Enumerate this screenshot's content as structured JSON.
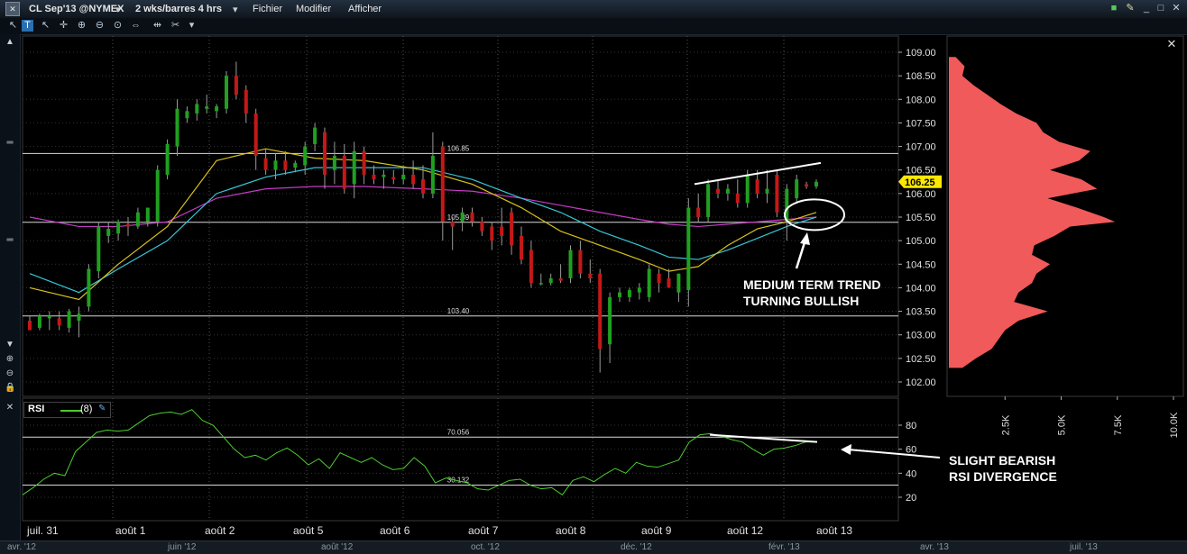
{
  "window": {
    "symbol": "CL Sep'13 @NYMEX",
    "period": "2 wks/barres 4 hrs",
    "menus": [
      "Fichier",
      "Modifier",
      "Afficher"
    ]
  },
  "colors": {
    "background": "#000000",
    "bull_candle": "#1fa11f",
    "bear_candle": "#c41818",
    "ma_fast": "#d9c21a",
    "ma_mid": "#39c6d6",
    "ma_slow": "#c43bc4",
    "volume_profile": "#f05a5a",
    "rsi_line": "#4dcc2f",
    "price_marker": "#ffe800"
  },
  "price_panel": {
    "y_ticks": [
      "109.00",
      "108.50",
      "108.00",
      "107.50",
      "107.00",
      "106.50",
      "106.00",
      "105.50",
      "105.00",
      "104.50",
      "104.00",
      "103.50",
      "103.00",
      "102.50",
      "102.00"
    ],
    "last_price": "106.25",
    "levels": [
      {
        "label": "106.85",
        "value": 106.85
      },
      {
        "label": "105.39",
        "value": 105.39
      },
      {
        "label": "103.40",
        "value": 103.4
      }
    ],
    "annotation": "MEDIUM TERM TREND\nTURNING BULLISH"
  },
  "rsi_panel": {
    "title": "RSI",
    "param": "(8)",
    "y_ticks": [
      "80",
      "60",
      "40",
      "20"
    ],
    "levels": [
      {
        "label": "70.056",
        "value": 70.056
      },
      {
        "label": "30.132",
        "value": 30.132
      }
    ],
    "annotation": "SLIGHT BEARISH\nRSI DIVERGENCE"
  },
  "x_axis_labels": [
    "juil. 31",
    "août 1",
    "août 2",
    "août 5",
    "août 6",
    "août 7",
    "août 8",
    "août 9",
    "août 12",
    "août 13"
  ],
  "profile_axis_labels": [
    "2.5K",
    "5.0K",
    "7.5K",
    "10.0K"
  ],
  "navigator_months": [
    "avr. '12",
    "juin '12",
    "août '12",
    "oct. '12",
    "déc. '12",
    "févr. '13",
    "avr. '13",
    "juil. '13"
  ],
  "chart_data": [
    {
      "type": "candlestick",
      "title": "CL Sep'13 @NYMEX",
      "ylim": [
        101.8,
        109.3
      ],
      "categories": [
        "juil. 31",
        "août 1",
        "août 2",
        "août 5",
        "août 6",
        "août 7",
        "août 8",
        "août 9",
        "août 12",
        "août 13"
      ],
      "candles": [
        {
          "o": 103.3,
          "h": 103.4,
          "l": 103.1,
          "c": 103.1
        },
        {
          "o": 103.15,
          "h": 103.45,
          "l": 103.1,
          "c": 103.4
        },
        {
          "o": 103.35,
          "h": 103.5,
          "l": 103.1,
          "c": 103.4
        },
        {
          "o": 103.35,
          "h": 103.5,
          "l": 103.1,
          "c": 103.2
        },
        {
          "o": 103.15,
          "h": 103.55,
          "l": 103.05,
          "c": 103.5
        },
        {
          "o": 103.3,
          "h": 103.6,
          "l": 102.95,
          "c": 103.45
        },
        {
          "o": 103.6,
          "h": 104.5,
          "l": 103.5,
          "c": 104.4
        },
        {
          "o": 104.35,
          "h": 105.4,
          "l": 104.2,
          "c": 105.3
        },
        {
          "o": 105.1,
          "h": 105.4,
          "l": 104.95,
          "c": 105.25
        },
        {
          "o": 105.15,
          "h": 105.45,
          "l": 105.0,
          "c": 105.4
        },
        {
          "o": 105.35,
          "h": 105.5,
          "l": 105.1,
          "c": 105.3
        },
        {
          "o": 105.3,
          "h": 105.7,
          "l": 105.25,
          "c": 105.6
        },
        {
          "o": 105.4,
          "h": 105.7,
          "l": 105.3,
          "c": 105.7
        },
        {
          "o": 105.4,
          "h": 106.6,
          "l": 105.3,
          "c": 106.5
        },
        {
          "o": 106.4,
          "h": 107.15,
          "l": 106.3,
          "c": 107.05
        },
        {
          "o": 107.0,
          "h": 108.0,
          "l": 106.8,
          "c": 107.8
        },
        {
          "o": 107.6,
          "h": 107.85,
          "l": 107.5,
          "c": 107.75
        },
        {
          "o": 107.7,
          "h": 108.0,
          "l": 107.55,
          "c": 107.9
        },
        {
          "o": 107.8,
          "h": 108.1,
          "l": 107.7,
          "c": 107.85
        },
        {
          "o": 107.75,
          "h": 107.9,
          "l": 107.6,
          "c": 107.85
        },
        {
          "o": 107.8,
          "h": 108.6,
          "l": 107.7,
          "c": 108.5
        },
        {
          "o": 108.5,
          "h": 108.8,
          "l": 108.0,
          "c": 108.1
        },
        {
          "o": 108.2,
          "h": 108.3,
          "l": 107.5,
          "c": 107.7
        },
        {
          "o": 107.7,
          "h": 107.8,
          "l": 106.5,
          "c": 106.8
        },
        {
          "o": 106.75,
          "h": 106.95,
          "l": 106.4,
          "c": 106.5
        },
        {
          "o": 106.5,
          "h": 106.85,
          "l": 106.3,
          "c": 106.7
        },
        {
          "o": 106.7,
          "h": 106.9,
          "l": 106.4,
          "c": 106.5
        },
        {
          "o": 106.55,
          "h": 106.7,
          "l": 106.45,
          "c": 106.65
        },
        {
          "o": 106.6,
          "h": 107.1,
          "l": 106.4,
          "c": 107.0
        },
        {
          "o": 107.05,
          "h": 107.5,
          "l": 106.9,
          "c": 107.4
        },
        {
          "o": 107.3,
          "h": 107.4,
          "l": 106.1,
          "c": 106.4
        },
        {
          "o": 106.5,
          "h": 107.1,
          "l": 106.2,
          "c": 106.8
        },
        {
          "o": 106.8,
          "h": 107.05,
          "l": 106.0,
          "c": 106.1
        },
        {
          "o": 106.2,
          "h": 107.1,
          "l": 105.9,
          "c": 106.9
        },
        {
          "o": 106.9,
          "h": 107.0,
          "l": 106.2,
          "c": 106.4
        },
        {
          "o": 106.4,
          "h": 106.6,
          "l": 106.2,
          "c": 106.3
        },
        {
          "o": 106.35,
          "h": 106.5,
          "l": 106.1,
          "c": 106.4
        },
        {
          "o": 106.35,
          "h": 106.5,
          "l": 106.2,
          "c": 106.3
        },
        {
          "o": 106.3,
          "h": 106.6,
          "l": 106.2,
          "c": 106.4
        },
        {
          "o": 106.4,
          "h": 106.7,
          "l": 106.1,
          "c": 106.2
        },
        {
          "o": 106.3,
          "h": 106.6,
          "l": 105.9,
          "c": 106.0
        },
        {
          "o": 106.0,
          "h": 107.3,
          "l": 105.9,
          "c": 106.8
        },
        {
          "o": 107.0,
          "h": 107.1,
          "l": 105.0,
          "c": 105.4
        },
        {
          "o": 105.4,
          "h": 105.5,
          "l": 104.8,
          "c": 105.3
        },
        {
          "o": 105.4,
          "h": 105.7,
          "l": 105.2,
          "c": 105.6
        },
        {
          "o": 105.6,
          "h": 105.7,
          "l": 105.3,
          "c": 105.4
        },
        {
          "o": 105.4,
          "h": 105.5,
          "l": 105.1,
          "c": 105.2
        },
        {
          "o": 105.3,
          "h": 105.4,
          "l": 104.8,
          "c": 105.0
        },
        {
          "o": 105.3,
          "h": 105.7,
          "l": 104.9,
          "c": 105.1
        },
        {
          "o": 105.6,
          "h": 105.7,
          "l": 104.7,
          "c": 104.9
        },
        {
          "o": 105.1,
          "h": 105.3,
          "l": 104.5,
          "c": 104.6
        },
        {
          "o": 104.8,
          "h": 105.0,
          "l": 104.0,
          "c": 104.1
        },
        {
          "o": 104.1,
          "h": 104.3,
          "l": 104.05,
          "c": 104.1
        },
        {
          "o": 104.1,
          "h": 104.3,
          "l": 104.05,
          "c": 104.2
        },
        {
          "o": 104.2,
          "h": 104.5,
          "l": 104.1,
          "c": 104.15
        },
        {
          "o": 104.2,
          "h": 104.9,
          "l": 104.1,
          "c": 104.8
        },
        {
          "o": 104.8,
          "h": 105.0,
          "l": 104.2,
          "c": 104.3
        },
        {
          "o": 104.3,
          "h": 104.6,
          "l": 104.1,
          "c": 104.2
        },
        {
          "o": 104.3,
          "h": 104.4,
          "l": 102.2,
          "c": 102.7
        },
        {
          "o": 102.8,
          "h": 103.9,
          "l": 102.4,
          "c": 103.8
        },
        {
          "o": 103.8,
          "h": 104.0,
          "l": 103.7,
          "c": 103.9
        },
        {
          "o": 103.8,
          "h": 104.0,
          "l": 103.7,
          "c": 103.95
        },
        {
          "o": 103.9,
          "h": 104.1,
          "l": 103.75,
          "c": 104.0
        },
        {
          "o": 103.8,
          "h": 104.5,
          "l": 103.7,
          "c": 104.4
        },
        {
          "o": 104.3,
          "h": 104.4,
          "l": 103.9,
          "c": 104.1
        },
        {
          "o": 104.2,
          "h": 104.4,
          "l": 104.0,
          "c": 104.0
        },
        {
          "o": 103.9,
          "h": 104.3,
          "l": 103.7,
          "c": 104.3
        },
        {
          "o": 103.95,
          "h": 105.9,
          "l": 103.6,
          "c": 105.7
        },
        {
          "o": 105.7,
          "h": 106.0,
          "l": 105.4,
          "c": 105.5
        },
        {
          "o": 105.5,
          "h": 106.3,
          "l": 105.4,
          "c": 106.2
        },
        {
          "o": 106.1,
          "h": 106.3,
          "l": 105.9,
          "c": 106.0
        },
        {
          "o": 106.0,
          "h": 106.2,
          "l": 105.85,
          "c": 106.1
        },
        {
          "o": 106.0,
          "h": 106.3,
          "l": 105.7,
          "c": 105.8
        },
        {
          "o": 105.8,
          "h": 106.5,
          "l": 105.7,
          "c": 106.4
        },
        {
          "o": 106.3,
          "h": 106.5,
          "l": 105.9,
          "c": 106.0
        },
        {
          "o": 106.0,
          "h": 106.5,
          "l": 105.8,
          "c": 106.1
        },
        {
          "o": 106.4,
          "h": 106.5,
          "l": 105.5,
          "c": 105.6
        },
        {
          "o": 105.4,
          "h": 106.2,
          "l": 105.0,
          "c": 106.1
        },
        {
          "o": 105.9,
          "h": 106.4,
          "l": 105.8,
          "c": 106.3
        },
        {
          "o": 106.2,
          "h": 106.25,
          "l": 106.1,
          "c": 106.15
        },
        {
          "o": 106.15,
          "h": 106.3,
          "l": 106.1,
          "c": 106.25
        }
      ],
      "ma_fast": [
        {
          "x": 0,
          "y": 104.0
        },
        {
          "x": 5,
          "y": 103.75
        },
        {
          "x": 9,
          "y": 104.5
        },
        {
          "x": 14,
          "y": 105.3
        },
        {
          "x": 19,
          "y": 106.7
        },
        {
          "x": 24,
          "y": 106.95
        },
        {
          "x": 29,
          "y": 106.75
        },
        {
          "x": 34,
          "y": 106.7
        },
        {
          "x": 40,
          "y": 106.5
        },
        {
          "x": 45,
          "y": 106.2
        },
        {
          "x": 50,
          "y": 105.7
        },
        {
          "x": 54,
          "y": 105.2
        },
        {
          "x": 58,
          "y": 104.9
        },
        {
          "x": 62,
          "y": 104.6
        },
        {
          "x": 65,
          "y": 104.35
        },
        {
          "x": 68,
          "y": 104.45
        },
        {
          "x": 71,
          "y": 104.9
        },
        {
          "x": 74,
          "y": 105.25
        },
        {
          "x": 77,
          "y": 105.4
        },
        {
          "x": 80,
          "y": 105.6
        }
      ],
      "ma_mid": [
        {
          "x": 0,
          "y": 104.3
        },
        {
          "x": 5,
          "y": 103.9
        },
        {
          "x": 9,
          "y": 104.4
        },
        {
          "x": 14,
          "y": 105.0
        },
        {
          "x": 19,
          "y": 106.0
        },
        {
          "x": 24,
          "y": 106.35
        },
        {
          "x": 29,
          "y": 106.55
        },
        {
          "x": 34,
          "y": 106.55
        },
        {
          "x": 40,
          "y": 106.55
        },
        {
          "x": 45,
          "y": 106.3
        },
        {
          "x": 50,
          "y": 105.9
        },
        {
          "x": 54,
          "y": 105.6
        },
        {
          "x": 58,
          "y": 105.2
        },
        {
          "x": 62,
          "y": 104.9
        },
        {
          "x": 65,
          "y": 104.65
        },
        {
          "x": 68,
          "y": 104.6
        },
        {
          "x": 71,
          "y": 104.8
        },
        {
          "x": 74,
          "y": 105.05
        },
        {
          "x": 77,
          "y": 105.3
        },
        {
          "x": 80,
          "y": 105.5
        }
      ],
      "ma_slow": [
        {
          "x": 0,
          "y": 105.5
        },
        {
          "x": 5,
          "y": 105.3
        },
        {
          "x": 9,
          "y": 105.3
        },
        {
          "x": 14,
          "y": 105.4
        },
        {
          "x": 19,
          "y": 105.9
        },
        {
          "x": 24,
          "y": 106.1
        },
        {
          "x": 29,
          "y": 106.15
        },
        {
          "x": 34,
          "y": 106.15
        },
        {
          "x": 40,
          "y": 106.1
        },
        {
          "x": 45,
          "y": 106.05
        },
        {
          "x": 50,
          "y": 105.9
        },
        {
          "x": 54,
          "y": 105.75
        },
        {
          "x": 58,
          "y": 105.6
        },
        {
          "x": 62,
          "y": 105.45
        },
        {
          "x": 65,
          "y": 105.35
        },
        {
          "x": 68,
          "y": 105.3
        },
        {
          "x": 71,
          "y": 105.35
        },
        {
          "x": 74,
          "y": 105.4
        },
        {
          "x": 77,
          "y": 105.45
        },
        {
          "x": 80,
          "y": 105.5
        }
      ]
    },
    {
      "type": "line",
      "title": "RSI",
      "ylim": [
        10,
        90
      ],
      "series": [
        {
          "name": "(8)",
          "x_range": [
            0,
            80
          ],
          "values": [
            22,
            28,
            35,
            40,
            38,
            58,
            66,
            74,
            76,
            75,
            76,
            82,
            88,
            90,
            91,
            89,
            93,
            84,
            80,
            70,
            60,
            53,
            55,
            51,
            57,
            61,
            55,
            47,
            52,
            44,
            57,
            53,
            49,
            53,
            47,
            43,
            44,
            53,
            46,
            32,
            36,
            34,
            32,
            27,
            26,
            30,
            34,
            35,
            30,
            27,
            28,
            22,
            34,
            37,
            33,
            39,
            44,
            40,
            49,
            46,
            45,
            48,
            51,
            66,
            72,
            73,
            71,
            68,
            66,
            60,
            55,
            60,
            61,
            63,
            66,
            66
          ]
        }
      ]
    },
    {
      "type": "bar",
      "title": "Volume profile",
      "xlim": [
        0,
        10000
      ],
      "ylim": [
        102.2,
        108.9
      ],
      "bins": [
        {
          "p": 108.9,
          "v": 300
        },
        {
          "p": 108.7,
          "v": 700
        },
        {
          "p": 108.5,
          "v": 600
        },
        {
          "p": 108.3,
          "v": 1100
        },
        {
          "p": 108.1,
          "v": 1700
        },
        {
          "p": 107.9,
          "v": 2300
        },
        {
          "p": 107.7,
          "v": 3000
        },
        {
          "p": 107.5,
          "v": 3900
        },
        {
          "p": 107.3,
          "v": 4200
        },
        {
          "p": 107.1,
          "v": 4900
        },
        {
          "p": 106.9,
          "v": 6300
        },
        {
          "p": 106.7,
          "v": 5800
        },
        {
          "p": 106.5,
          "v": 4500
        },
        {
          "p": 106.3,
          "v": 5900
        },
        {
          "p": 106.1,
          "v": 6600
        },
        {
          "p": 105.9,
          "v": 4400
        },
        {
          "p": 105.7,
          "v": 5700
        },
        {
          "p": 105.5,
          "v": 6900
        },
        {
          "p": 105.4,
          "v": 7400
        },
        {
          "p": 105.3,
          "v": 5400
        },
        {
          "p": 105.1,
          "v": 4700
        },
        {
          "p": 104.9,
          "v": 3800
        },
        {
          "p": 104.7,
          "v": 3700
        },
        {
          "p": 104.5,
          "v": 4500
        },
        {
          "p": 104.3,
          "v": 3900
        },
        {
          "p": 104.1,
          "v": 3700
        },
        {
          "p": 103.9,
          "v": 3100
        },
        {
          "p": 103.7,
          "v": 2900
        },
        {
          "p": 103.5,
          "v": 4400
        },
        {
          "p": 103.3,
          "v": 3100
        },
        {
          "p": 103.1,
          "v": 2500
        },
        {
          "p": 102.9,
          "v": 2200
        },
        {
          "p": 102.7,
          "v": 1900
        },
        {
          "p": 102.5,
          "v": 1200
        },
        {
          "p": 102.3,
          "v": 600
        }
      ]
    }
  ]
}
